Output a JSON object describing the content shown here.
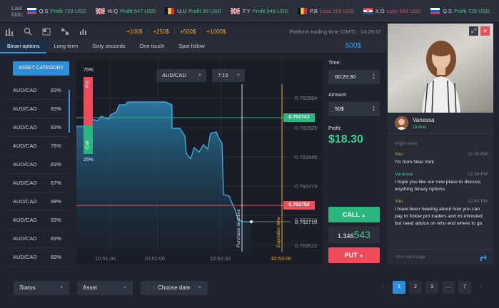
{
  "ticker": {
    "label": "Last bids:",
    "bids": [
      {
        "flag": "ru",
        "name": "Q.S",
        "result": "Profit 729 USD",
        "type": "profit"
      },
      {
        "flag": "gb",
        "name": "W.Q",
        "result": "Profit 547 USD",
        "type": "profit"
      },
      {
        "flag": "be",
        "name": "U.U",
        "result": "Profit 38 USD",
        "type": "profit"
      },
      {
        "flag": "gb",
        "name": "F.Y",
        "result": "Profit 949 USD",
        "type": "profit"
      },
      {
        "flag": "be",
        "name": "P.B",
        "result": "Loss 119 USD",
        "type": "loss"
      },
      {
        "flag": "hr",
        "name": "X.O",
        "result": "Loss 541 USD",
        "type": "loss"
      },
      {
        "flag": "ru",
        "name": "Q.S",
        "result": "Profit 729 USD",
        "type": "profit"
      }
    ]
  },
  "toolbar": {
    "amounts": [
      "+100$",
      "+250$",
      "+500$",
      "+1000$"
    ],
    "trading_time": "Platform trading time (GMT) - 14:29:37"
  },
  "tabs": [
    "Binari options",
    "Long term",
    "Sixty seconds",
    "One touch",
    "Spot follow"
  ],
  "balance": "500$",
  "sidebar": {
    "category_button": "ASSET CATEGORY",
    "assets": [
      {
        "name": "AUD/CAD",
        "pct": "83%"
      },
      {
        "name": "AUD/CAD",
        "pct": "83%"
      },
      {
        "name": "AUD/CAD",
        "pct": "83%"
      },
      {
        "name": "AUD/CAD",
        "pct": "76%"
      },
      {
        "name": "AUD/CAD",
        "pct": "83%"
      },
      {
        "name": "AUD/CAD",
        "pct": "67%"
      },
      {
        "name": "AUD/CAD",
        "pct": "99%"
      },
      {
        "name": "AUD/CAD",
        "pct": "83%"
      },
      {
        "name": "AUD/CAD",
        "pct": "83%"
      },
      {
        "name": "AUD/CAD",
        "pct": "83%"
      }
    ]
  },
  "chart": {
    "pair": "AUD/CAD",
    "timeframe": "7:15",
    "put_pct": "75%",
    "call_pct": "25%",
    "put_label": "Put",
    "call_label": "Call",
    "y_ticks": [
      "0.702984",
      "0.702925",
      "0.702845",
      "0.702773",
      "0.702710",
      "0.702612"
    ],
    "x_ticks": [
      "10:51:30",
      "10:52:00",
      "10:52:30",
      "10:53:00"
    ],
    "call_price": "0.702741",
    "put_price": "0.702750",
    "current_price": "0.702710",
    "purchase_label": "Purchase deadline",
    "expiration_label": "Expiration time",
    "colors": {
      "call": "#2bb57f",
      "put": "#ef4b5b",
      "expiration": "#e9a93b"
    }
  },
  "panel": {
    "time_label": "Time:",
    "time_value": "00:20:30",
    "amount_label": "Amount:",
    "amount_value": "50$",
    "profit_label": "Profit:",
    "profit_value": "$18.30",
    "call_label": "CALL",
    "price_small": "1.346",
    "price_big": "543",
    "put_label": "PUT"
  },
  "chat": {
    "agent_name": "Vanessa",
    "agent_status": "Online",
    "typing": "might have",
    "messages": [
      {
        "author": "You",
        "type": "you",
        "time": "12:35 PM",
        "text": "I'm from New York"
      },
      {
        "author": "Vanessa",
        "type": "agent",
        "time": "12:36 PM",
        "text": "I hope you like our new place to discuss anything binary options."
      },
      {
        "author": "You",
        "type": "you",
        "time": "12:40 PM",
        "text": "I have been hearing about how you can pay to follow pro traders and im intrested but need advice on who and where to go"
      }
    ],
    "input_placeholder": "Your message"
  },
  "footer": {
    "status": "Status",
    "asset": "Asset",
    "date": "Choose date",
    "pages": [
      "1",
      "2",
      "3",
      "...",
      "7"
    ]
  }
}
